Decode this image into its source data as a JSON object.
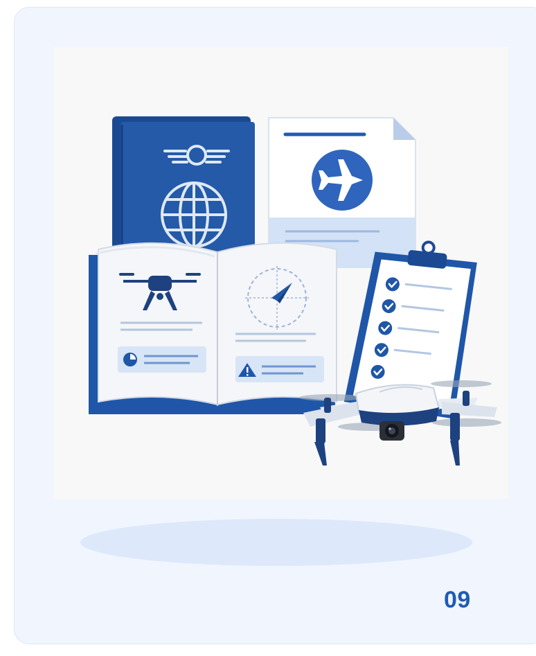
{
  "card": {
    "number": "09"
  },
  "colors": {
    "accent": "#1f5bb3",
    "navy": "#1e4a96",
    "card_background": "#f1f6fe",
    "light_blue": "#dde9fa"
  },
  "illustration": {
    "icons": [
      "passport-icon",
      "airplane-document-icon",
      "open-book-icon",
      "drone-icon",
      "compass-icon",
      "warning-icon",
      "clipboard-checklist-icon",
      "camera-drone-icon"
    ]
  }
}
